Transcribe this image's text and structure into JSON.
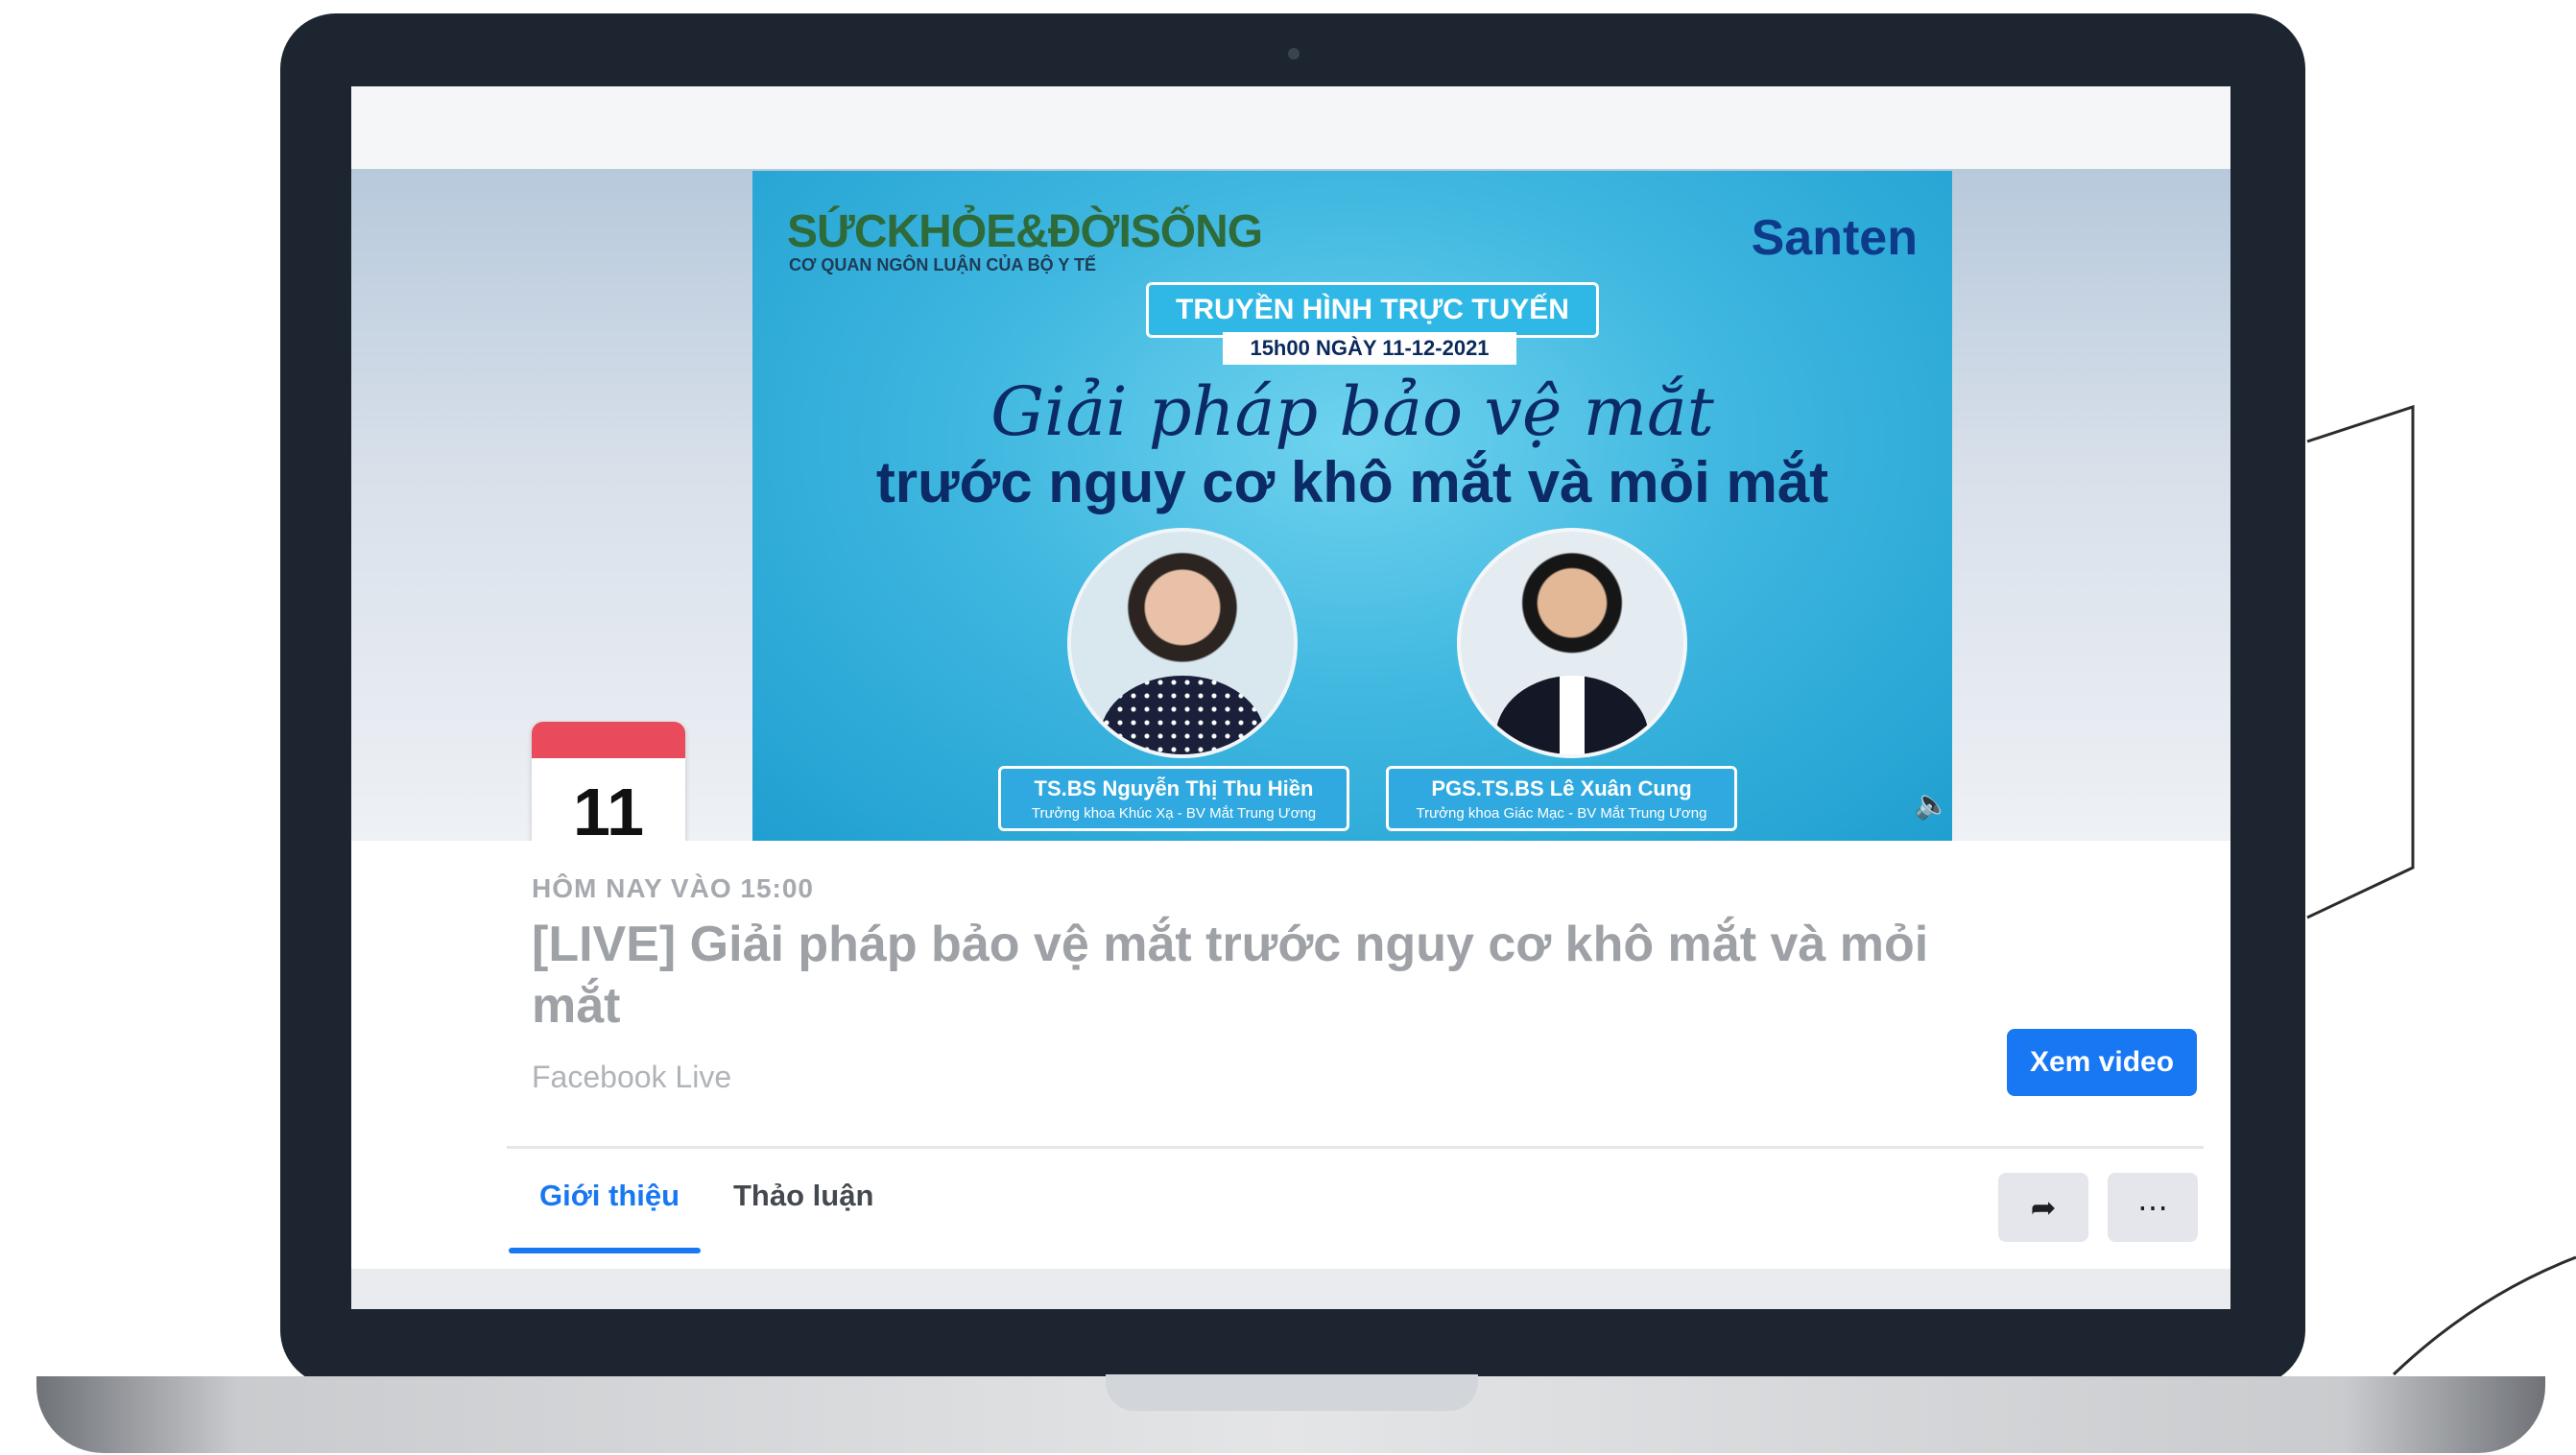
{
  "cover": {
    "brand_left": "SỨCKHỎE&ĐỜISỐNG",
    "brand_left_sub": "CƠ QUAN NGÔN LUẬN CỦA BỘ Y TẾ",
    "brand_right": "Santen",
    "badge": "TRUYỀN HÌNH TRỰC TUYẾN",
    "date": "15h00 NGÀY 11-12-2021",
    "title_script": "Giải pháp bảo vệ mắt",
    "title_bold": "trước nguy cơ khô mắt và mỏi mắt",
    "speakers": [
      {
        "name": "TS.BS Nguyễn Thị Thu Hiền",
        "role": "Trưởng khoa Khúc Xạ - BV Mắt Trung Ương"
      },
      {
        "name": "PGS.TS.BS Lê Xuân Cung",
        "role": "Trưởng khoa Giác Mạc - BV Mắt Trung Ương"
      }
    ]
  },
  "calendar": {
    "day": "11"
  },
  "event": {
    "when": "HÔM NAY VÀO 15:00",
    "title": "[LIVE] Giải pháp bảo vệ mắt trước nguy cơ khô mắt và mỏi mắt",
    "subtitle": "Facebook Live",
    "watch_label": "Xem video"
  },
  "tabs": [
    {
      "label": "Giới thiệu",
      "active": true
    },
    {
      "label": "Thảo luận",
      "active": false
    }
  ],
  "icons": {
    "share": "share-icon",
    "more": "more-icon",
    "volume": "volume-icon"
  },
  "colors": {
    "accent": "#1877f2",
    "calendar_red": "#e94a5c",
    "frame": "#1d2630"
  }
}
